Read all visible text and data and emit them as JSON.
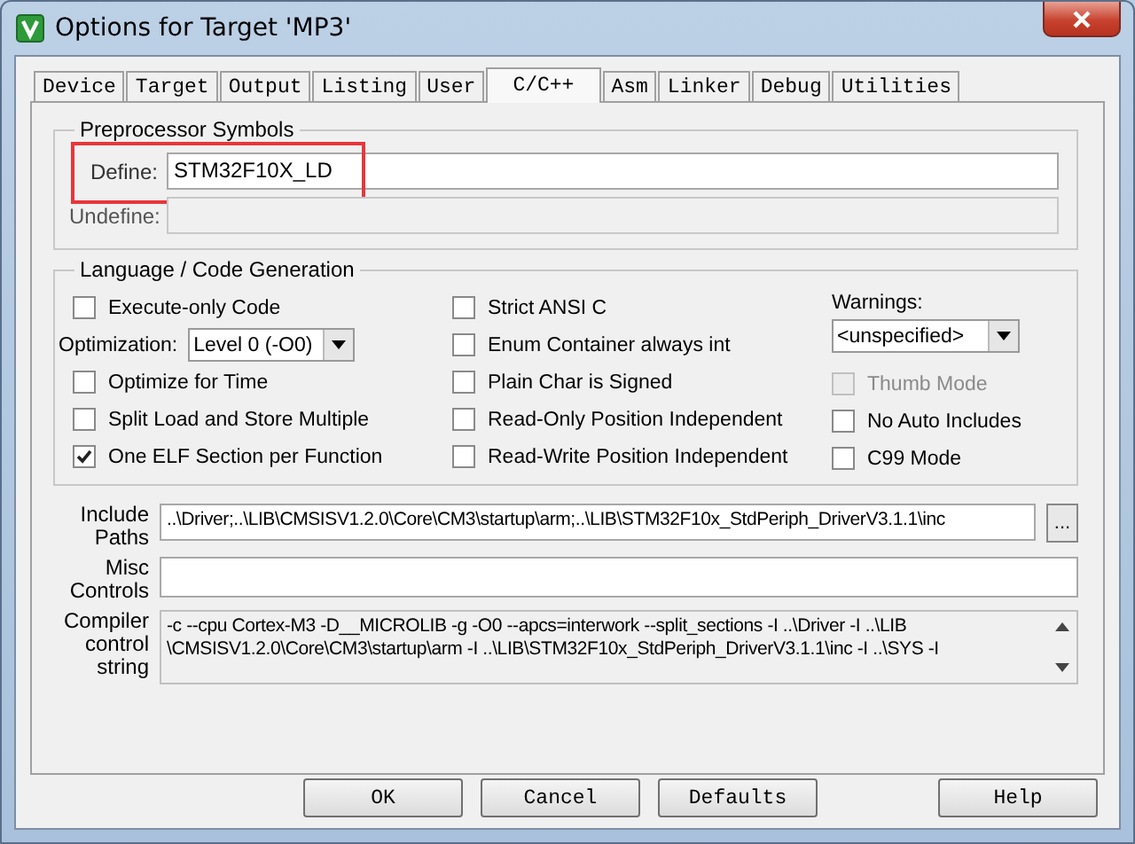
{
  "window": {
    "title": "Options for Target 'MP3'"
  },
  "tabs": [
    {
      "label": "Device",
      "selected": false
    },
    {
      "label": "Target",
      "selected": false
    },
    {
      "label": "Output",
      "selected": false
    },
    {
      "label": "Listing",
      "selected": false
    },
    {
      "label": "User",
      "selected": false
    },
    {
      "label": "C/C++",
      "selected": true
    },
    {
      "label": "Asm",
      "selected": false
    },
    {
      "label": "Linker",
      "selected": false
    },
    {
      "label": "Debug",
      "selected": false
    },
    {
      "label": "Utilities",
      "selected": false
    }
  ],
  "preprocessor": {
    "title": "Preprocessor Symbols",
    "fields": [
      {
        "label": "Define:",
        "value": "STM32F10X_LD",
        "disabled": false
      },
      {
        "label": "Undefine:",
        "disabled": true
      }
    ]
  },
  "language": {
    "title": "Language / Code Generation",
    "columns": [
      [
        {
          "kind": "checkbox",
          "label": "Execute-only Code",
          "checked": false,
          "disabled": false
        },
        {
          "kind": "inline_select",
          "label": "Optimization:",
          "value": "Level 0 (-O0)"
        },
        {
          "kind": "checkbox",
          "label": "Optimize for Time",
          "checked": false,
          "disabled": false
        },
        {
          "kind": "checkbox",
          "label": "Split Load and Store Multiple",
          "checked": false,
          "disabled": false
        },
        {
          "kind": "checkbox",
          "label": "One ELF Section per Function",
          "checked": true,
          "disabled": false
        }
      ],
      [
        {
          "kind": "checkbox",
          "label": "Strict ANSI C",
          "checked": false,
          "disabled": false
        },
        {
          "kind": "checkbox",
          "label": "Enum Container always int",
          "checked": false,
          "disabled": false
        },
        {
          "kind": "checkbox",
          "label": "Plain Char is Signed",
          "checked": false,
          "disabled": false
        },
        {
          "kind": "checkbox",
          "label": "Read-Only Position Independent",
          "checked": false,
          "disabled": false
        },
        {
          "kind": "checkbox",
          "label": "Read-Write Position Independent",
          "checked": false,
          "disabled": false
        }
      ],
      [
        {
          "kind": "stacked_select",
          "label": "Warnings:",
          "value": "<unspecified>"
        },
        {
          "kind": "checkbox",
          "label": "Thumb Mode",
          "checked": false,
          "disabled": true
        },
        {
          "kind": "checkbox",
          "label": "No Auto Includes",
          "checked": false,
          "disabled": false
        },
        {
          "kind": "checkbox",
          "label": "C99 Mode",
          "checked": false,
          "disabled": false
        }
      ]
    ]
  },
  "options": [
    {
      "kind": "browse",
      "label": "Include Paths",
      "value": "..\\Driver;..\\LIB\\CMSISV1.2.0\\Core\\CM3\\startup\\arm;..\\LIB\\STM32F10x_StdPeriph_DriverV3.1.1\\inc",
      "button": "..."
    },
    {
      "kind": "text",
      "label": "Misc Controls"
    },
    {
      "kind": "multiline",
      "label": "Compiler control string",
      "lines": [
        "-c --cpu Cortex-M3 -D__MICROLIB -g -O0 --apcs=interwork --split_sections -I ..\\Driver -I ..\\LIB",
        "\\CMSISV1.2.0\\Core\\CM3\\startup\\arm -I ..\\LIB\\STM32F10x_StdPeriph_DriverV3.1.1\\inc -I ..\\SYS -I"
      ]
    }
  ],
  "buttons": [
    "OK",
    "Cancel",
    "Defaults",
    "Help"
  ]
}
